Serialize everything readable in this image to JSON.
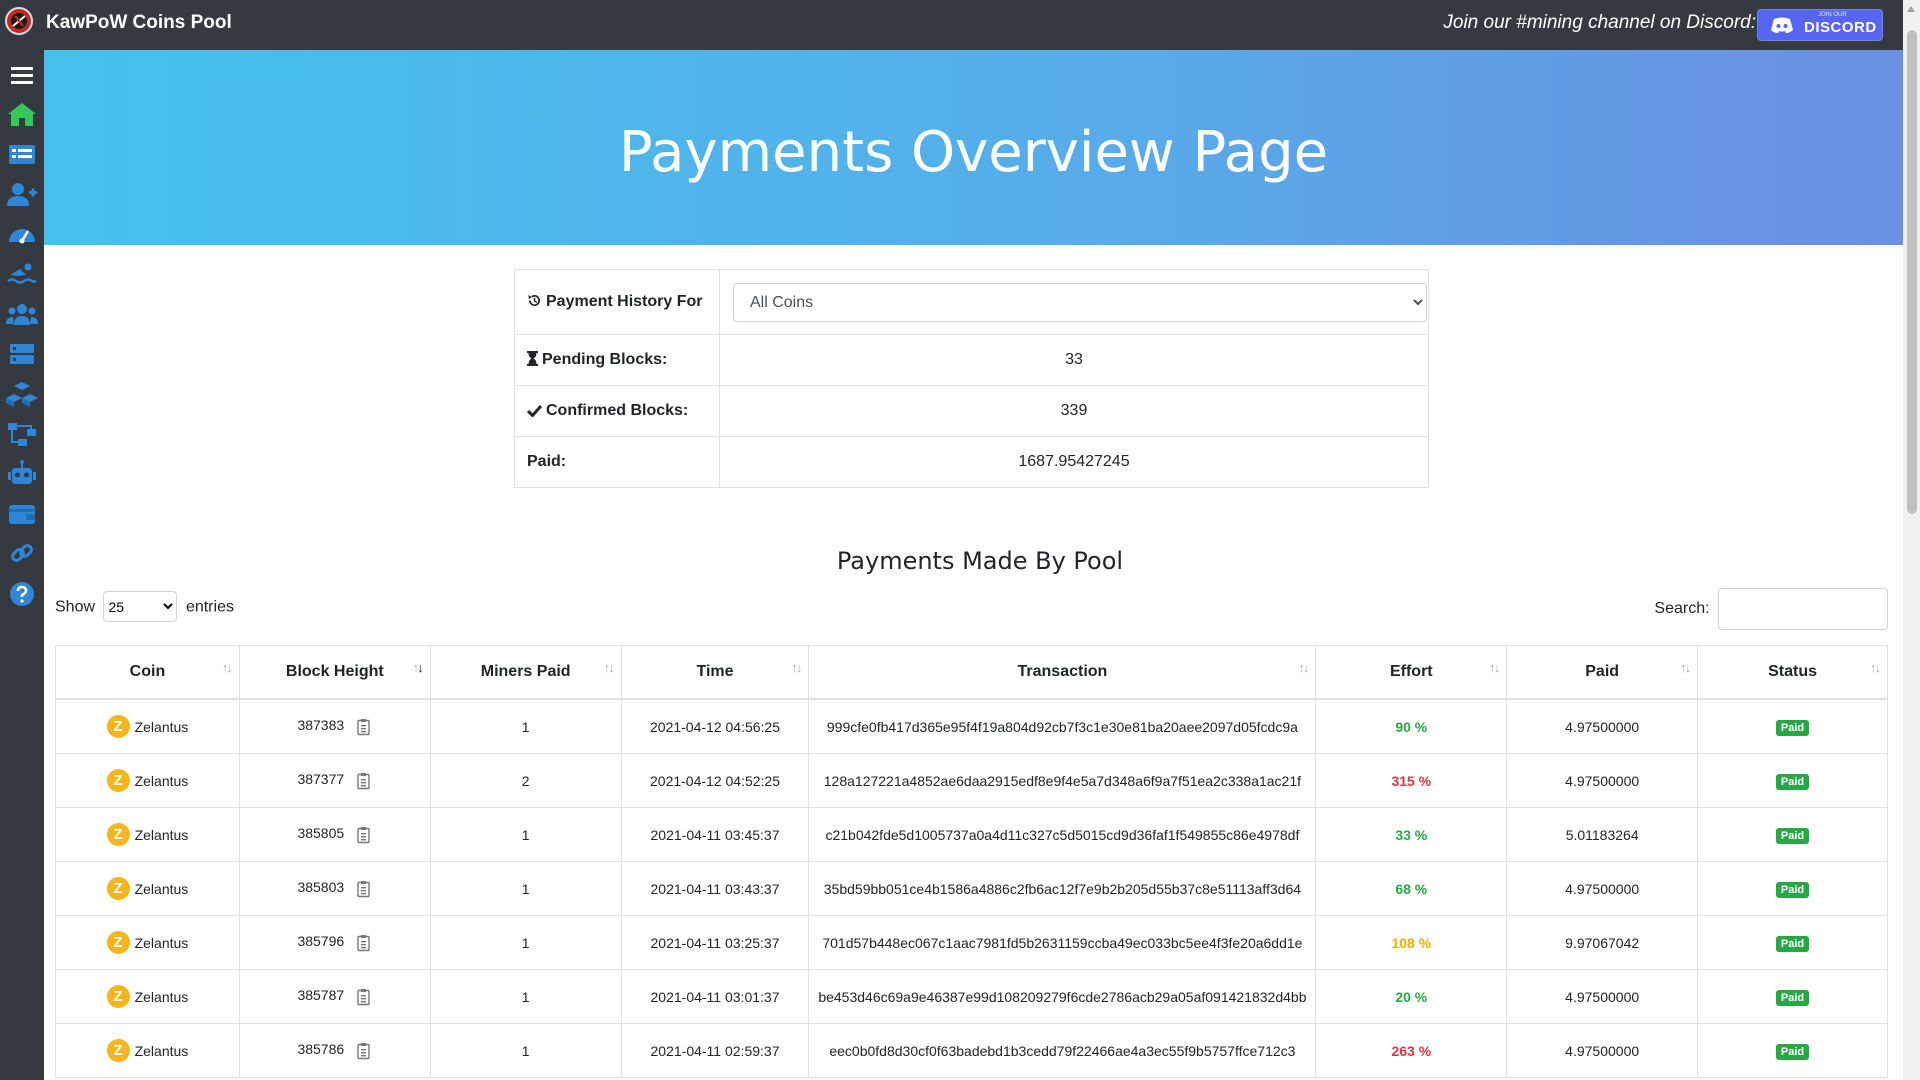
{
  "topbar": {
    "brand": "KawPoW Coins Pool",
    "discord_text": "Join our #mining channel on Discord:",
    "discord_small": "JOIN OUR",
    "discord_word": "DISCORD"
  },
  "hero": {
    "title": "Payments Overview Page"
  },
  "summary": {
    "history_label": "Payment History For",
    "coin_selected": "All Coins",
    "pending_label": "Pending Blocks:",
    "pending_value": "33",
    "confirmed_label": "Confirmed Blocks:",
    "confirmed_value": "339",
    "paid_label": "Paid:",
    "paid_value": "1687.95427245"
  },
  "payments": {
    "title": "Payments Made By Pool",
    "show_label": "Show",
    "entries_value": "25",
    "entries_label": "entries",
    "search_label": "Search:",
    "columns": [
      "Coin",
      "Block Height",
      "Miners Paid",
      "Time",
      "Transaction",
      "Effort",
      "Paid",
      "Status"
    ],
    "rows": [
      {
        "coin": "Zelantus",
        "block": "387383",
        "miners": "1",
        "time": "2021-04-12 04:56:25",
        "tx": "999cfe0fb417d365e95f4f19a804d92cb7f3c1e30e81ba20aee2097d05fcdc9a",
        "effort": "90 %",
        "paid": "4.97500000",
        "status": "Paid"
      },
      {
        "coin": "Zelantus",
        "block": "387377",
        "miners": "2",
        "time": "2021-04-12 04:52:25",
        "tx": "128a127221a4852ae6daa2915edf8e9f4e5a7d348a6f9a7f51ea2c338a1ac21f",
        "effort": "315 %",
        "paid": "4.97500000",
        "status": "Paid"
      },
      {
        "coin": "Zelantus",
        "block": "385805",
        "miners": "1",
        "time": "2021-04-11 03:45:37",
        "tx": "c21b042fde5d1005737a0a4d11c327c5d5015cd9d36faf1f549855c86e4978df",
        "effort": "33 %",
        "paid": "5.01183264",
        "status": "Paid"
      },
      {
        "coin": "Zelantus",
        "block": "385803",
        "miners": "1",
        "time": "2021-04-11 03:43:37",
        "tx": "35bd59bb051ce4b1586a4886c2fb6ac12f7e9b2b205d55b37c8e51113aff3d64",
        "effort": "68 %",
        "paid": "4.97500000",
        "status": "Paid"
      },
      {
        "coin": "Zelantus",
        "block": "385796",
        "miners": "1",
        "time": "2021-04-11 03:25:37",
        "tx": "701d57b448ec067c1aac7981fd5b2631159ccba49ec033bc5ee4f3fe20a6dd1e",
        "effort": "108 %",
        "paid": "9.97067042",
        "status": "Paid"
      },
      {
        "coin": "Zelantus",
        "block": "385787",
        "miners": "1",
        "time": "2021-04-11 03:01:37",
        "tx": "be453d46c69a9e46387e99d108209279f6cde2786acb29a05af091421832d4bb",
        "effort": "20 %",
        "paid": "4.97500000",
        "status": "Paid"
      },
      {
        "coin": "Zelantus",
        "block": "385786",
        "miners": "1",
        "time": "2021-04-11 02:59:37",
        "tx": "eec0b0fd8d30cf0f63badebd1b3cedd79f22466ae4a3ec55f9b5757ffce712c3",
        "effort": "263 %",
        "paid": "4.97500000",
        "status": "Paid"
      }
    ]
  },
  "colors": {
    "effort_low": "#28a745",
    "effort_mid": "#f0ad00",
    "effort_high": "#dc3545",
    "sidebar_green": "#34c759",
    "sidebar_blue": "#2f86d6"
  }
}
